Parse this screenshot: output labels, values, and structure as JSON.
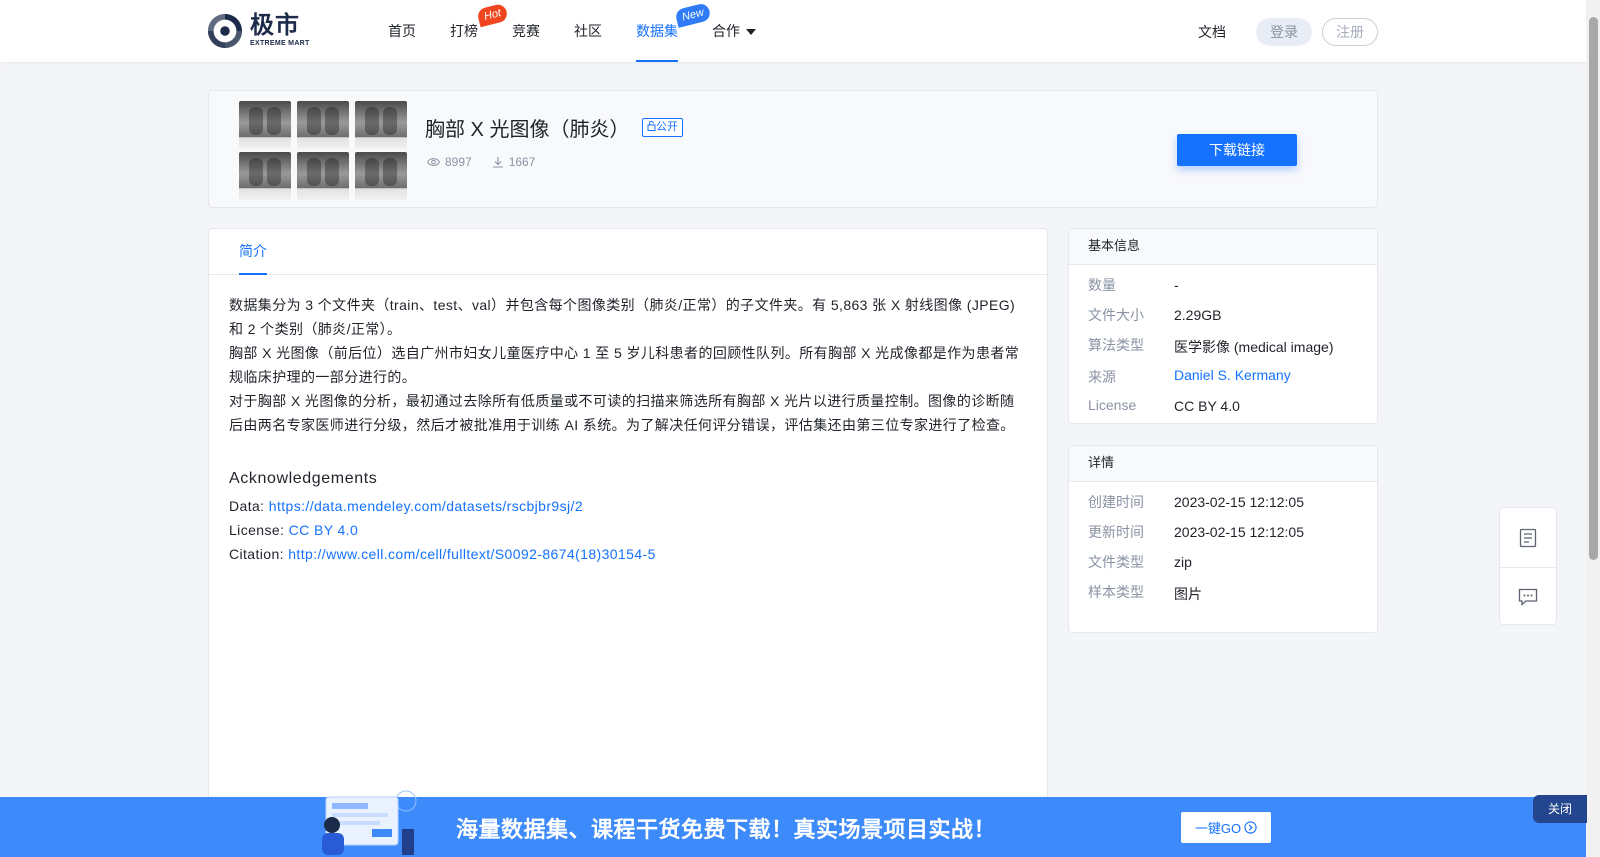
{
  "header": {
    "logo_cn": "极市",
    "logo_en": "EXTREME MART",
    "nav": [
      {
        "label": "首页",
        "badge": "",
        "active": false
      },
      {
        "label": "打榜",
        "badge": "Hot",
        "active": false
      },
      {
        "label": "竞赛",
        "badge": "",
        "active": false
      },
      {
        "label": "社区",
        "badge": "",
        "active": false
      },
      {
        "label": "数据集",
        "badge": "New",
        "active": true
      },
      {
        "label": "合作",
        "badge": "",
        "active": false,
        "dropdown": true
      }
    ],
    "docs_label": "文档",
    "login_label": "登录",
    "register_label": "注册"
  },
  "dataset": {
    "title": "胸部 X 光图像（肺炎）",
    "visibility": "公开",
    "views": "8997",
    "downloads": "1667",
    "download_button": "下载链接"
  },
  "intro": {
    "tab_label": "简介",
    "paragraphs": [
      "数据集分为 3 个文件夹（train、test、val）并包含每个图像类别（肺炎/正常）的子文件夹。有 5,863 张 X 射线图像 (JPEG) 和 2 个类别（肺炎/正常）。",
      "胸部 X 光图像（前后位）选自广州市妇女儿童医疗中心 1 至 5 岁儿科患者的回顾性队列。所有胸部 X 光成像都是作为患者常规临床护理的一部分进行的。",
      "对于胸部 X 光图像的分析，最初通过去除所有低质量或不可读的扫描来筛选所有胸部 X 光片以进行质量控制。图像的诊断随后由两名专家医师进行分级，然后才被批准用于训练 AI 系统。为了解决任何评分错误，评估集还由第三位专家进行了检查。"
    ],
    "ack_title": "Acknowledgements",
    "ack": {
      "data_label": "Data: ",
      "data_link": "https://data.mendeley.com/datasets/rscbjbr9sj/2",
      "license_label": "License: ",
      "license_link": "CC BY 4.0",
      "citation_label": "Citation: ",
      "citation_link": "http://www.cell.com/cell/fulltext/S0092-8674(18)30154-5"
    }
  },
  "basic_info": {
    "title": "基本信息",
    "rows": [
      {
        "key": "数量",
        "value": "-"
      },
      {
        "key": "文件大小",
        "value": "2.29GB"
      },
      {
        "key": "算法类型",
        "value": "医学影像 (medical image)"
      },
      {
        "key": "来源",
        "value": "Daniel S. Kermany"
      },
      {
        "key": "License",
        "value": "CC BY 4.0"
      }
    ]
  },
  "details": {
    "title": "详情",
    "rows": [
      {
        "key": "创建时间",
        "value": "2023-02-15 12:12:05"
      },
      {
        "key": "更新时间",
        "value": "2023-02-15 12:12:05"
      },
      {
        "key": "文件类型",
        "value": "zip"
      },
      {
        "key": "样本类型",
        "value": "图片"
      }
    ]
  },
  "float_toolbar": {
    "icons": [
      "document-icon",
      "message-icon"
    ]
  },
  "banner": {
    "text": "海量数据集、课程干货免费下载！真实场景项目实战！",
    "go_label": "一键GO",
    "close_label": "关闭"
  },
  "colors": {
    "accent": "#1472ff",
    "hot": "#f0451f",
    "banner": "#3d8bfb"
  }
}
